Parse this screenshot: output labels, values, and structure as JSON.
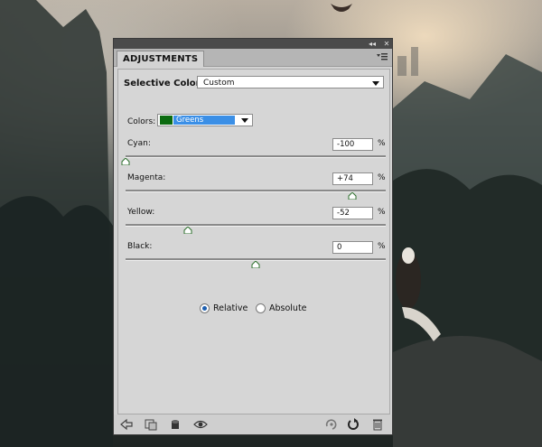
{
  "panel": {
    "tab_title": "ADJUSTMENTS",
    "heading": "Selective Color",
    "preset": {
      "value": "Custom"
    },
    "colors": {
      "label": "Colors:",
      "selected": "Greens",
      "swatch_color": "#0b6b10",
      "highlight_color": "#3b8fe6"
    },
    "sliders": [
      {
        "label": "Cyan:",
        "value": "-100",
        "unit": "%",
        "amount": -100
      },
      {
        "label": "Magenta:",
        "value": "+74",
        "unit": "%",
        "amount": 74
      },
      {
        "label": "Yellow:",
        "value": "-52",
        "unit": "%",
        "amount": -52
      },
      {
        "label": "Black:",
        "value": "0",
        "unit": "%",
        "amount": 0
      }
    ],
    "method": {
      "options": [
        {
          "label": "Relative",
          "selected": true
        },
        {
          "label": "Absolute",
          "selected": false
        }
      ]
    },
    "titlebar_icons": [
      "collapse-icon",
      "close-icon"
    ],
    "bottom_icons": [
      "back-icon",
      "clip-to-layer-icon",
      "visibility-mask-icon",
      "eye-icon",
      "previous-state-icon",
      "reset-icon",
      "trash-icon"
    ]
  }
}
